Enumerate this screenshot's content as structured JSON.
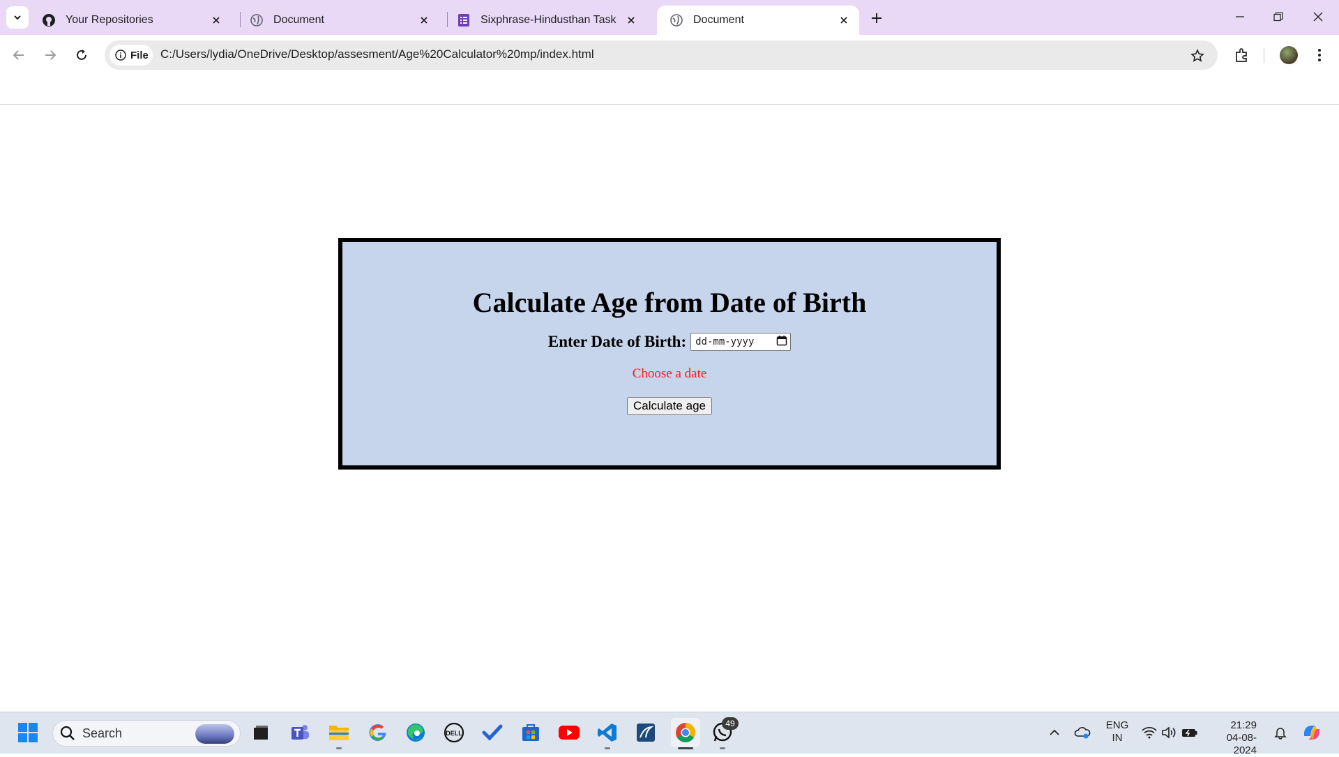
{
  "browser": {
    "tabs": [
      {
        "title": "Your Repositories",
        "icon": "github-icon"
      },
      {
        "title": "Document",
        "icon": "globe-icon"
      },
      {
        "title": "Sixphrase-Hindusthan Task",
        "icon": "forms-icon"
      },
      {
        "title": "Document",
        "icon": "globe-icon",
        "active": true
      }
    ],
    "security_chip": "File",
    "url": "C:/Users/lydia/OneDrive/Desktop/assesment/Age%20Calculator%20mp/index.html"
  },
  "page": {
    "heading": "Calculate Age from Date of Birth",
    "dob_label": "Enter Date of Birth:",
    "dob_placeholder": "dd-mm-yyyy",
    "error_text": "Choose a date",
    "calc_button": "Calculate age",
    "colors": {
      "card_bg": "#c6d5ec",
      "error": "#ff1a1a",
      "border": "#000000"
    }
  },
  "taskbar": {
    "search_label": "Search",
    "whatsapp_badge": "49",
    "lang_line1": "ENG",
    "lang_line2": "IN",
    "time": "21:29",
    "date": "04-08-2024"
  }
}
